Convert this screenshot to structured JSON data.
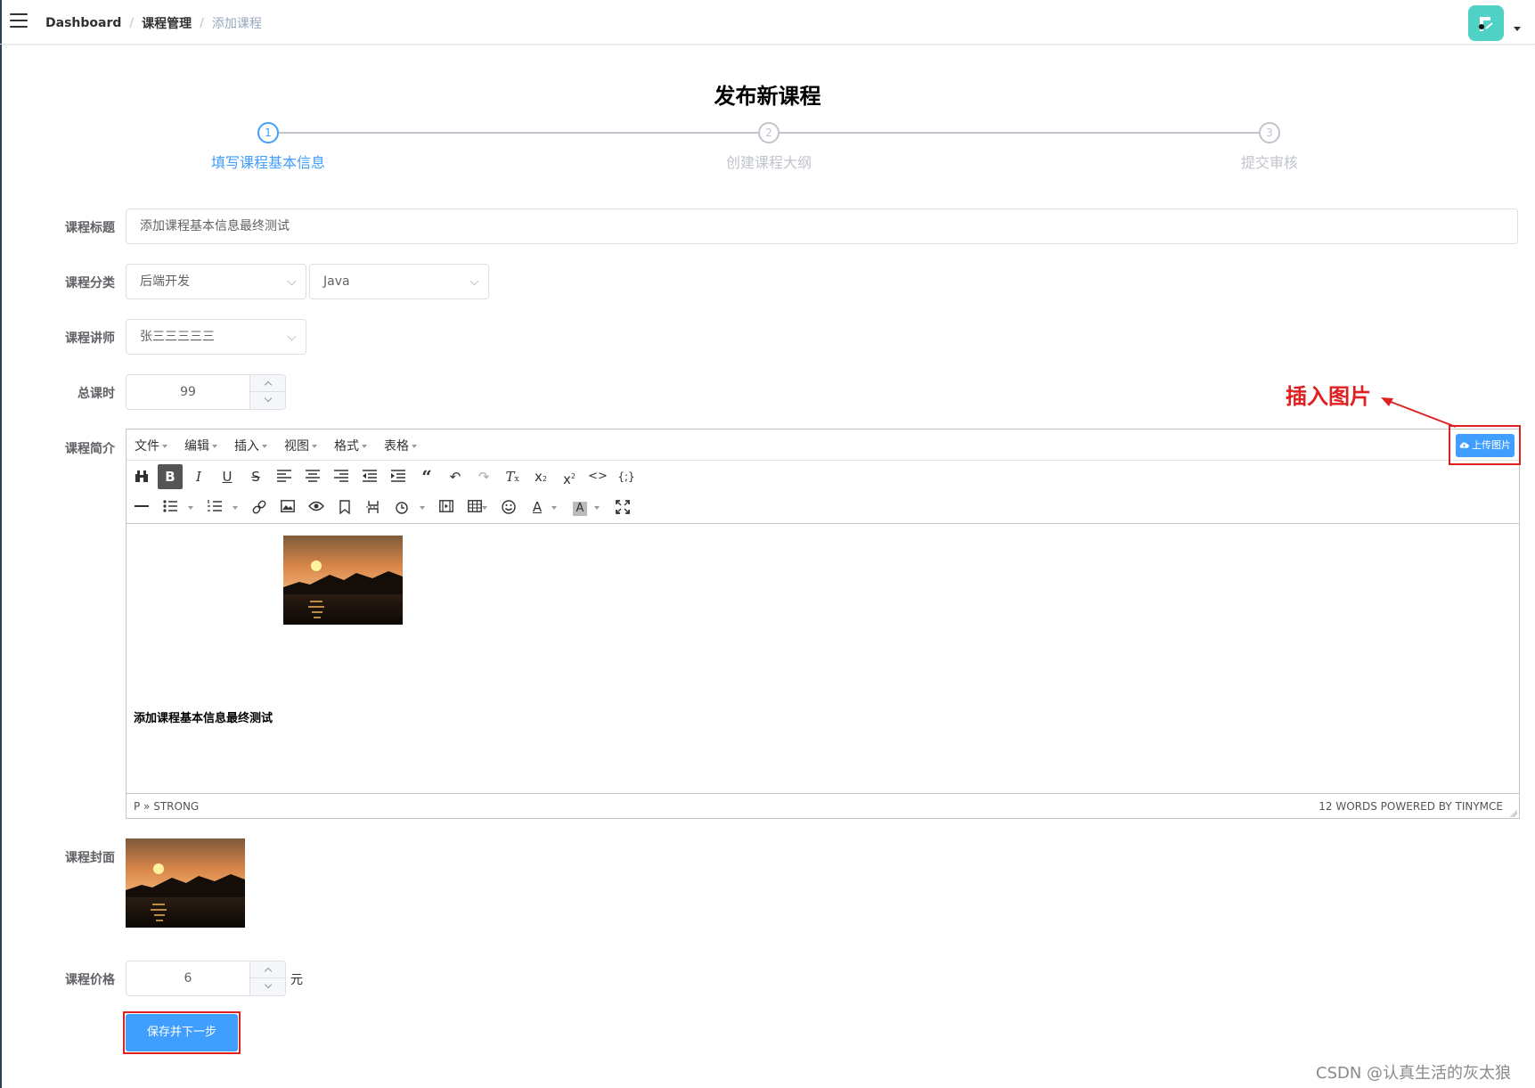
{
  "breadcrumb": [
    "Dashboard",
    "课程管理",
    "添加课程"
  ],
  "page_title": "发布新课程",
  "steps": [
    {
      "number": "1",
      "title": "填写课程基本信息",
      "active": true
    },
    {
      "number": "2",
      "title": "创建课程大纲",
      "active": false
    },
    {
      "number": "3",
      "title": "提交审核",
      "active": false
    }
  ],
  "form": {
    "title_label": "课程标题",
    "title_value": "添加课程基本信息最终测试",
    "category_label": "课程分类",
    "category_level1": "后端开发",
    "category_level2": "Java",
    "teacher_label": "课程讲师",
    "teacher_value": "张三三三三三",
    "hours_label": "总课时",
    "hours_value": "99",
    "desc_label": "课程简介",
    "cover_label": "课程封面",
    "price_label": "课程价格",
    "price_value": "6",
    "price_unit": "元",
    "save_button": "保存并下一步"
  },
  "editor": {
    "menus": [
      "文件",
      "编辑",
      "插入",
      "视图",
      "格式",
      "表格"
    ],
    "toolbar_row1": [
      "binoculars-icon",
      "bold-icon",
      "italic-icon",
      "underline-icon",
      "strikethrough-icon",
      "align-left-icon",
      "align-center-icon",
      "align-right-icon",
      "outdent-icon",
      "indent-icon",
      "blockquote-icon",
      "undo-icon",
      "redo-icon",
      "clear-format-icon",
      "subscript-icon",
      "superscript-icon",
      "code-icon",
      "code-sample-icon"
    ],
    "toolbar_row2": [
      "horizontal-rule-icon",
      "bullet-list-icon",
      "numbered-list-icon",
      "link-icon",
      "image-icon",
      "preview-icon",
      "bookmark-icon",
      "page-break-icon",
      "time-icon",
      "media-icon",
      "table-icon",
      "emoji-icon",
      "text-color-icon",
      "background-color-icon",
      "fullscreen-icon"
    ],
    "content_text": "添加课程基本信息最终测试",
    "status_path": "P » STRONG",
    "status_words": "12 WORDS POWERED BY TINYMCE",
    "upload_button": "上传图片"
  },
  "annotation": "插入图片",
  "watermark": "CSDN @认真生活的灰太狼",
  "colors": {
    "primary": "#409eff",
    "annotation": "#e02020",
    "avatar": "#4fd1c5"
  }
}
